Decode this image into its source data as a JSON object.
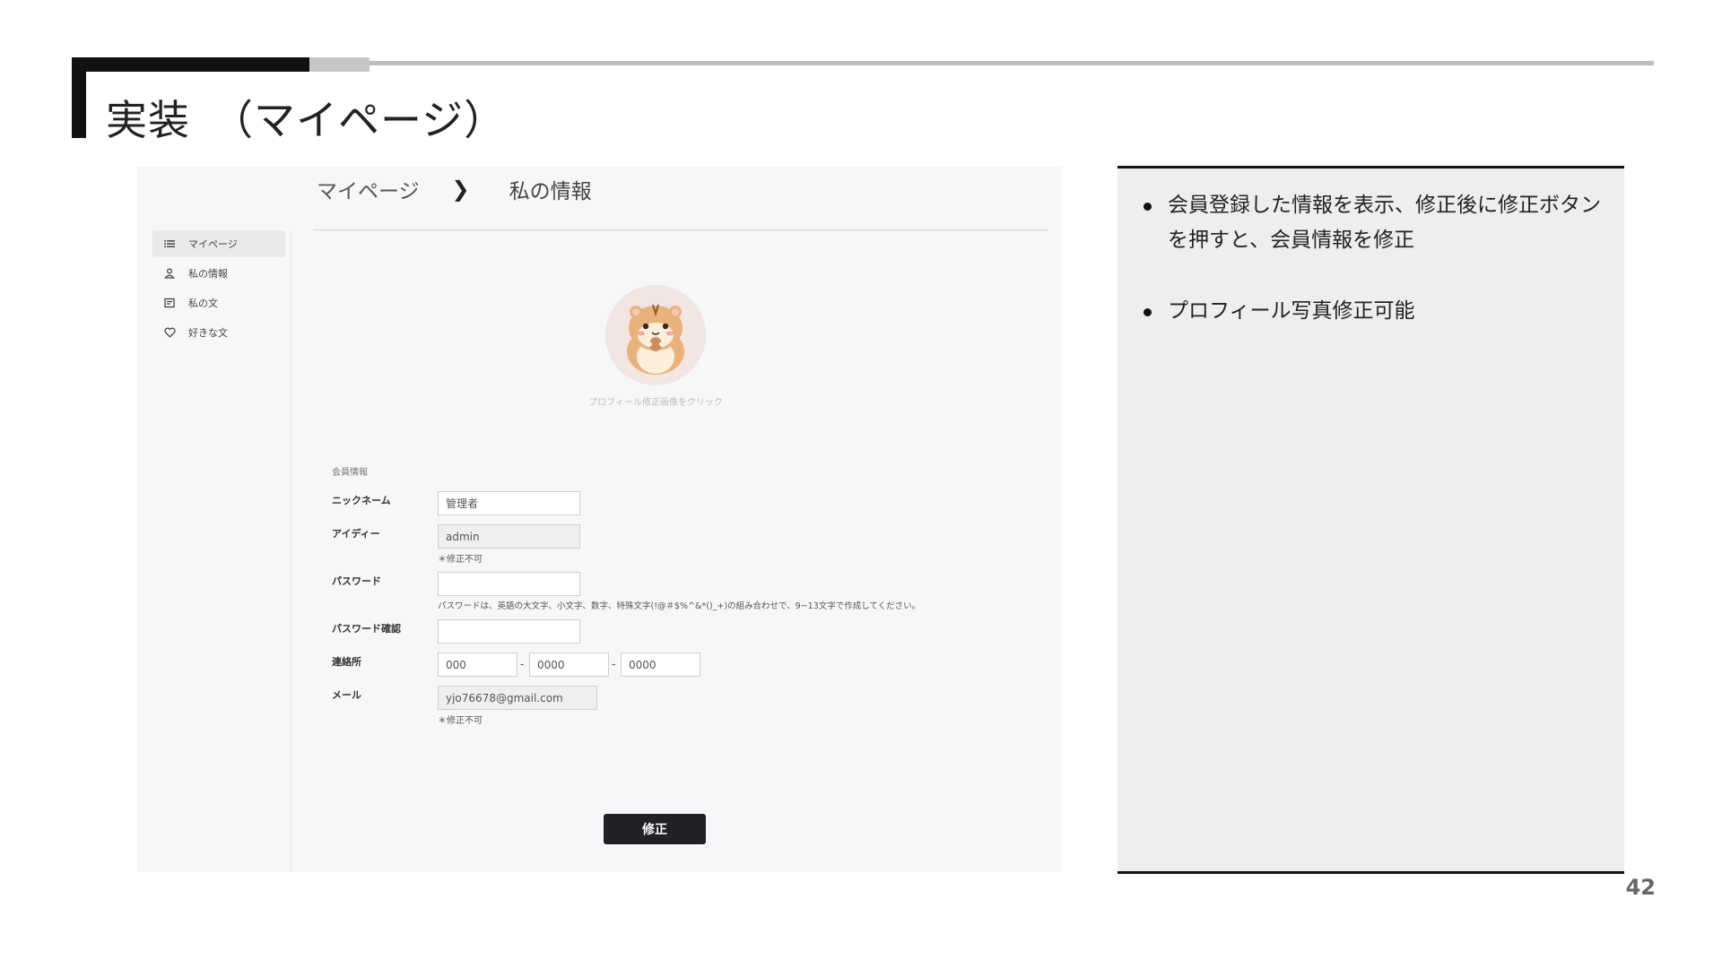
{
  "slide": {
    "title": "実装　（マイページ）",
    "page_number": "42"
  },
  "screenshot": {
    "breadcrumb": {
      "parent": "マイページ",
      "separator": "❯",
      "current": "私の情報"
    },
    "sidebar": {
      "items": [
        {
          "label": "マイページ",
          "icon": "list-icon",
          "active": true
        },
        {
          "label": "私の情報",
          "icon": "user-icon",
          "active": false
        },
        {
          "label": "私の文",
          "icon": "note-icon",
          "active": false
        },
        {
          "label": "好きな文",
          "icon": "heart-icon",
          "active": false
        }
      ]
    },
    "profile": {
      "avatar": "hamster-avatar-icon",
      "caption": "プロフィール修正画像をクリック"
    },
    "form": {
      "section_label": "会員情報",
      "nickname": {
        "label": "ニックネーム",
        "value": "管理者"
      },
      "user_id": {
        "label": "アイディー",
        "value": "admin",
        "note": "＊修正不可"
      },
      "password": {
        "label": "パスワード",
        "value": "",
        "hint": "パスワードは、英語の大文字、小文字、数字、特殊文字(!@＃$%^&*()_+)の組み合わせで、9~13文字で作成してください。"
      },
      "password_confirm": {
        "label": "パスワード確認",
        "value": ""
      },
      "phone": {
        "label": "連絡所",
        "part1": "000",
        "part2": "0000",
        "part3": "0000",
        "separator": "-"
      },
      "email": {
        "label": "メール",
        "value": "yjo76678@gmail.com",
        "note": "＊修正不可"
      },
      "submit_label": "修正"
    }
  },
  "notes": {
    "bullets": [
      "会員登録した情報を表示、修正後に修正ボタンを押すと、会員情報を修正",
      "プロフィール写真修正可能"
    ]
  }
}
